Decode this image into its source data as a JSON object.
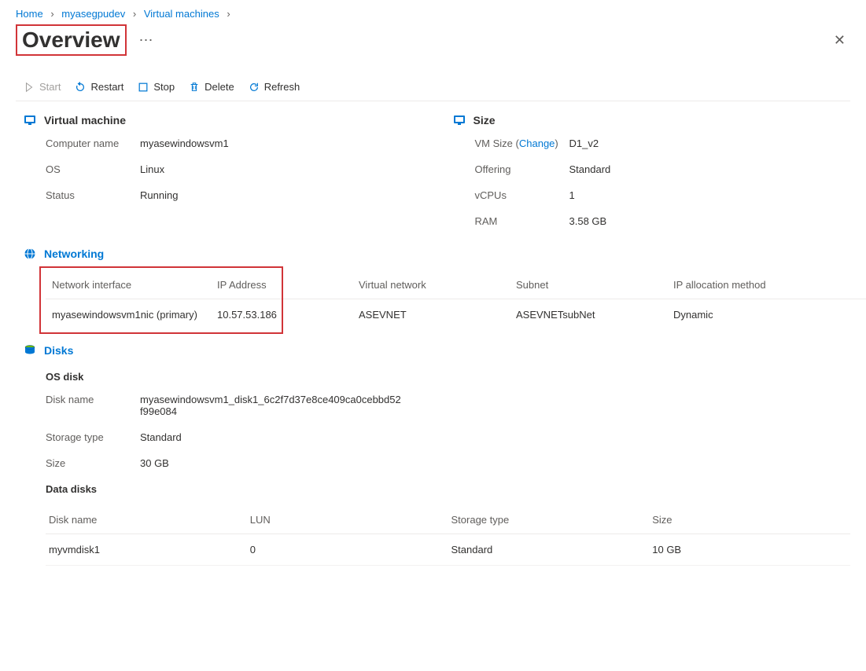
{
  "breadcrumb": {
    "items": [
      "Home",
      "myasegpudev",
      "Virtual machines"
    ]
  },
  "title": "Overview",
  "toolbar": {
    "start": "Start",
    "restart": "Restart",
    "stop": "Stop",
    "delete": "Delete",
    "refresh": "Refresh"
  },
  "vm_section": {
    "heading": "Virtual machine",
    "labels": {
      "computer_name": "Computer name",
      "os": "OS",
      "status": "Status"
    },
    "values": {
      "computer_name": "myasewindowsvm1",
      "os": "Linux",
      "status": "Running"
    }
  },
  "size_section": {
    "heading": "Size",
    "labels": {
      "vm_size": "VM Size",
      "change": "Change",
      "offering": "Offering",
      "vcpus": "vCPUs",
      "ram": "RAM"
    },
    "values": {
      "vm_size": "D1_v2",
      "offering": "Standard",
      "vcpus": "1",
      "ram": "3.58 GB"
    }
  },
  "networking": {
    "heading": "Networking",
    "columns": {
      "nic": "Network interface",
      "ip": "IP Address",
      "vnet": "Virtual network",
      "subnet": "Subnet",
      "alloc": "IP allocation method"
    },
    "row": {
      "nic": "myasewindowsvm1nic (primary)",
      "ip": "10.57.53.186",
      "vnet": "ASEVNET",
      "subnet": "ASEVNETsubNet",
      "alloc": "Dynamic"
    }
  },
  "disks": {
    "heading": "Disks",
    "os_disk_heading": "OS disk",
    "labels": {
      "disk_name": "Disk name",
      "storage_type": "Storage type",
      "size": "Size"
    },
    "os_disk": {
      "name": "myasewindowsvm1_disk1_6c2f7d37e8ce409ca0cebbd52f99e084",
      "storage_type": "Standard",
      "size": "30 GB"
    },
    "data_disks_heading": "Data disks",
    "table_columns": {
      "name": "Disk name",
      "lun": "LUN",
      "storage_type": "Storage type",
      "size": "Size"
    },
    "data_disk_row": {
      "name": "myvmdisk1",
      "lun": "0",
      "storage_type": "Standard",
      "size": "10 GB"
    }
  }
}
